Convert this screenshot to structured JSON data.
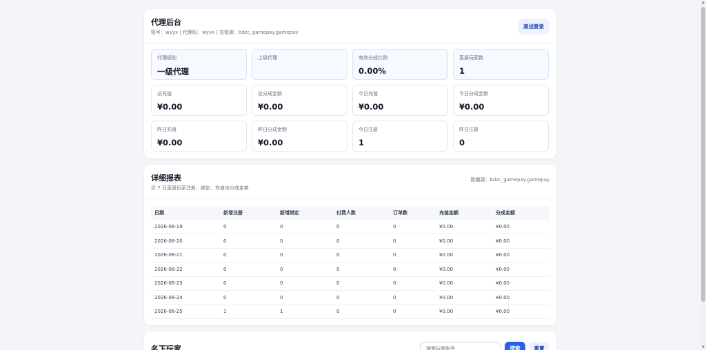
{
  "header": {
    "title": "代理后台",
    "subtitle": "账号：wyyx  |  代理码：wyyx  |  充值源：bdzc_gamepay.gamepay",
    "logout_label": "退出登录"
  },
  "stats": [
    {
      "label": "代理级别",
      "value": "一级代理"
    },
    {
      "label": "上级代理",
      "value": ""
    },
    {
      "label": "有效分成比例",
      "value": "0.00%"
    },
    {
      "label": "直属玩家数",
      "value": "1"
    },
    {
      "label": "总充值",
      "value": "¥0.00"
    },
    {
      "label": "总分成金额",
      "value": "¥0.00"
    },
    {
      "label": "今日充值",
      "value": "¥0.00"
    },
    {
      "label": "今日分成金额",
      "value": "¥0.00"
    },
    {
      "label": "昨日充值",
      "value": "¥0.00"
    },
    {
      "label": "昨日分成金额",
      "value": "¥0.00"
    },
    {
      "label": "今日注册",
      "value": "1"
    },
    {
      "label": "昨日注册",
      "value": "0"
    }
  ],
  "report": {
    "title": "详细报表",
    "subtitle": "近 7 日直属玩家注册、绑定、充值与分成走势",
    "source": "数据源：bdzc_gamepay.gamepay",
    "columns": [
      "日期",
      "新增注册",
      "新增绑定",
      "付费人数",
      "订单数",
      "充值金额",
      "分成金额"
    ],
    "rows": [
      [
        "2026-08-19",
        "0",
        "0",
        "0",
        "0",
        "¥0.00",
        "¥0.00"
      ],
      [
        "2026-08-20",
        "0",
        "0",
        "0",
        "0",
        "¥0.00",
        "¥0.00"
      ],
      [
        "2026-08-21",
        "0",
        "0",
        "0",
        "0",
        "¥0.00",
        "¥0.00"
      ],
      [
        "2026-08-22",
        "0",
        "0",
        "0",
        "0",
        "¥0.00",
        "¥0.00"
      ],
      [
        "2026-08-23",
        "0",
        "0",
        "0",
        "0",
        "¥0.00",
        "¥0.00"
      ],
      [
        "2026-08-24",
        "0",
        "0",
        "0",
        "0",
        "¥0.00",
        "¥0.00"
      ],
      [
        "2026-08-25",
        "1",
        "1",
        "0",
        "0",
        "¥0.00",
        "¥0.00"
      ]
    ]
  },
  "players": {
    "title": "名下玩家",
    "search_placeholder": "搜索玩家账号",
    "search_label": "搜索",
    "reset_label": "重置"
  },
  "colors": {
    "accent": "#2563eb",
    "background": "#f3f5f9"
  }
}
